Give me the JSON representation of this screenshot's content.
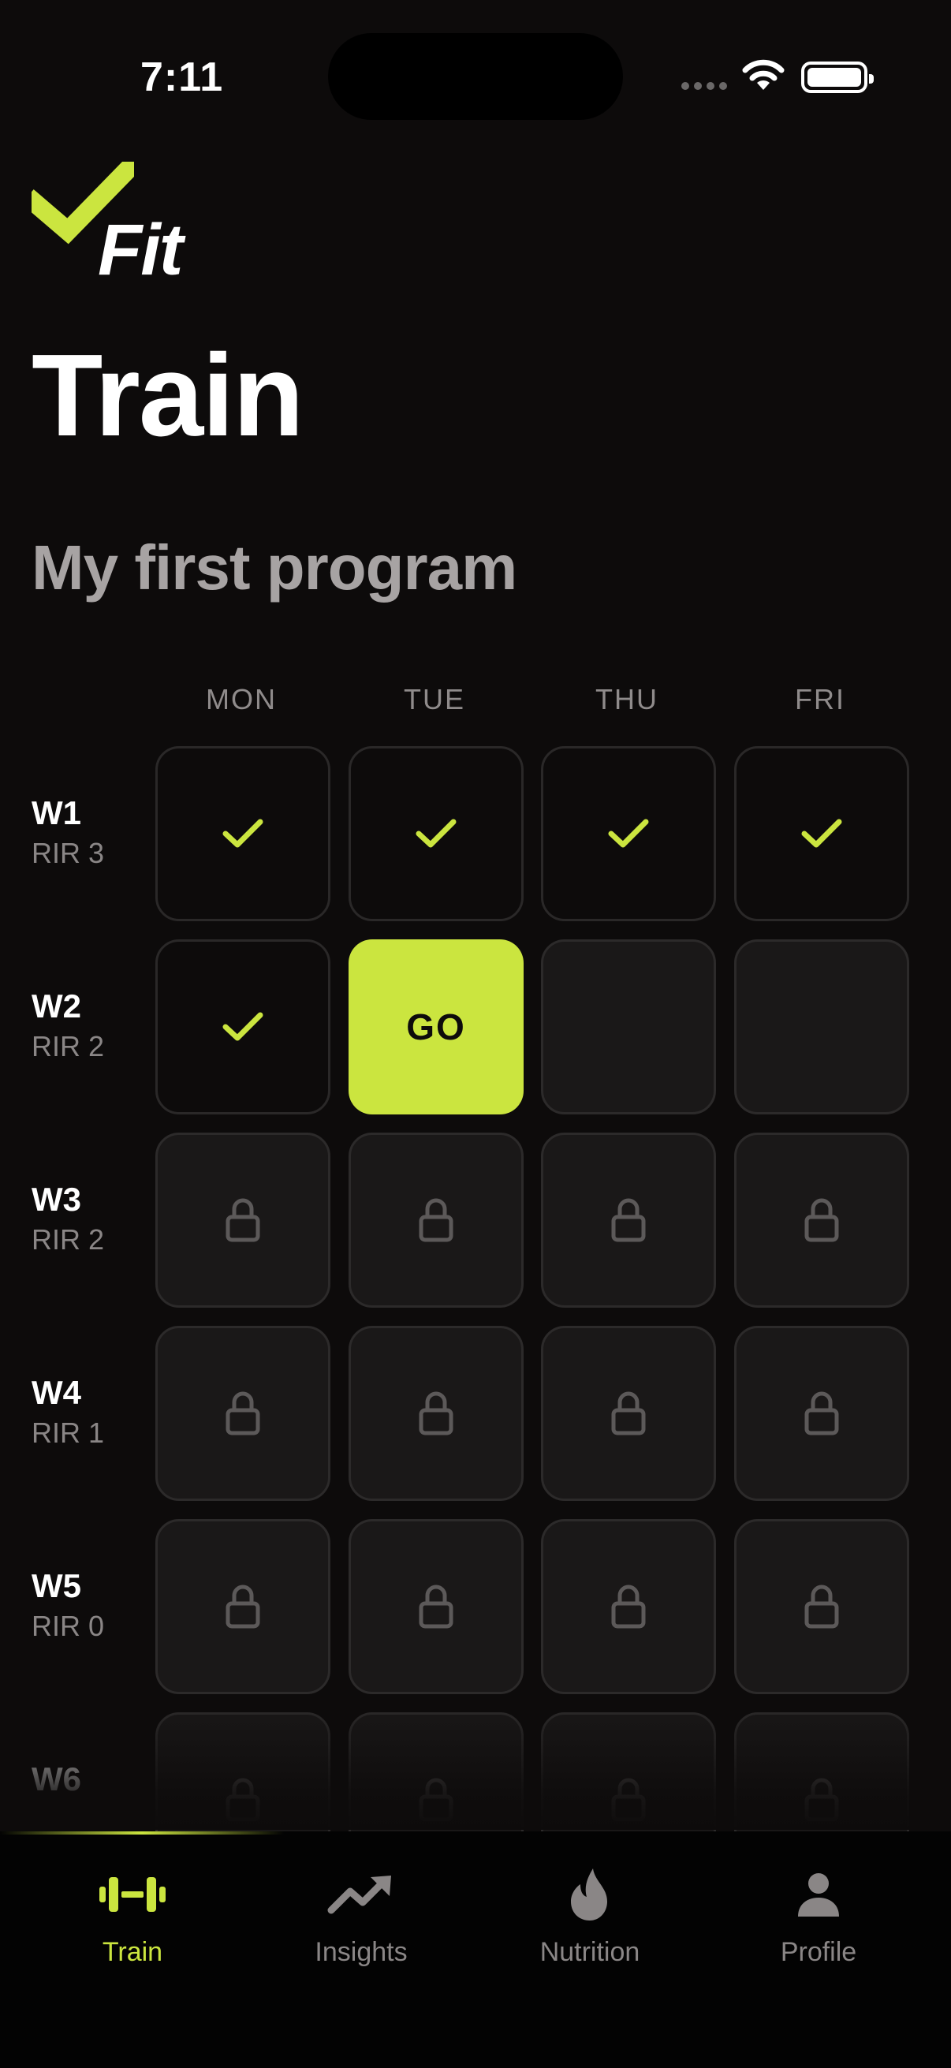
{
  "status": {
    "time": "7:11"
  },
  "app": {
    "logo_text": "Fit"
  },
  "page_title": "Train",
  "program_title": "My first program",
  "days": [
    "MON",
    "TUE",
    "THU",
    "FRI"
  ],
  "weeks": [
    {
      "label": "W1",
      "rir": "RIR 3",
      "cells": [
        "done",
        "done",
        "done",
        "done"
      ]
    },
    {
      "label": "W2",
      "rir": "RIR 2",
      "cells": [
        "done",
        "go",
        "open",
        "open"
      ]
    },
    {
      "label": "W3",
      "rir": "RIR 2",
      "cells": [
        "locked",
        "locked",
        "locked",
        "locked"
      ]
    },
    {
      "label": "W4",
      "rir": "RIR 1",
      "cells": [
        "locked",
        "locked",
        "locked",
        "locked"
      ]
    },
    {
      "label": "W5",
      "rir": "RIR 0",
      "cells": [
        "locked",
        "locked",
        "locked",
        "locked"
      ]
    },
    {
      "label": "W6",
      "rir": "",
      "cells": [
        "locked",
        "locked",
        "locked",
        "locked"
      ]
    }
  ],
  "go_label": "GO",
  "tabs": [
    {
      "label": "Train",
      "icon": "dumbbell-icon",
      "active": true
    },
    {
      "label": "Insights",
      "icon": "trend-icon",
      "active": false
    },
    {
      "label": "Nutrition",
      "icon": "flame-icon",
      "active": false
    },
    {
      "label": "Profile",
      "icon": "person-icon",
      "active": false
    }
  ],
  "colors": {
    "accent": "#cbe53f",
    "background": "#0d0b0b",
    "muted": "#8a8686"
  }
}
